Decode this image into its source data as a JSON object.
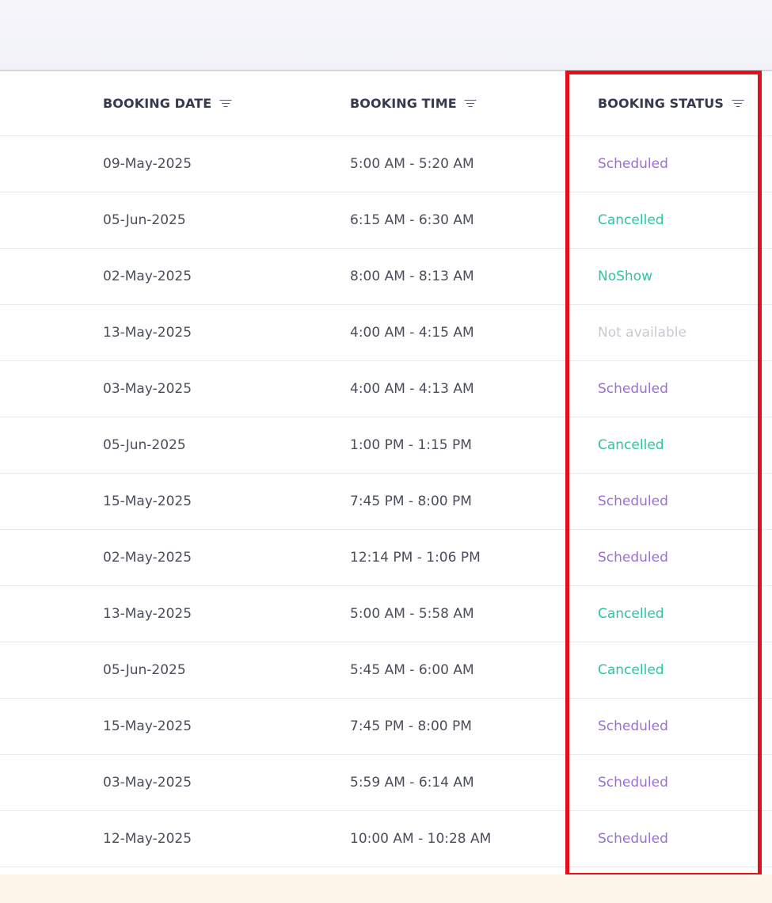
{
  "table": {
    "columns": [
      {
        "label": "BOOKING DATE"
      },
      {
        "label": "BOOKING TIME"
      },
      {
        "label": "BOOKING STATUS"
      }
    ],
    "rows": [
      {
        "date": "09-May-2025",
        "time": "5:00 AM - 5:20 AM",
        "status": "Scheduled"
      },
      {
        "date": "05-Jun-2025",
        "time": "6:15 AM - 6:30 AM",
        "status": "Cancelled"
      },
      {
        "date": "02-May-2025",
        "time": "8:00 AM - 8:13 AM",
        "status": "NoShow"
      },
      {
        "date": "13-May-2025",
        "time": "4:00 AM - 4:15 AM",
        "status": "Not available"
      },
      {
        "date": "03-May-2025",
        "time": "4:00 AM - 4:13 AM",
        "status": "Scheduled"
      },
      {
        "date": "05-Jun-2025",
        "time": "1:00 PM - 1:15 PM",
        "status": "Cancelled"
      },
      {
        "date": "15-May-2025",
        "time": "7:45 PM - 8:00 PM",
        "status": "Scheduled"
      },
      {
        "date": "02-May-2025",
        "time": "12:14 PM - 1:06 PM",
        "status": "Scheduled"
      },
      {
        "date": "13-May-2025",
        "time": "5:00 AM - 5:58 AM",
        "status": "Cancelled"
      },
      {
        "date": "05-Jun-2025",
        "time": "5:45 AM - 6:00 AM",
        "status": "Cancelled"
      },
      {
        "date": "15-May-2025",
        "time": "7:45 PM - 8:00 PM",
        "status": "Scheduled"
      },
      {
        "date": "03-May-2025",
        "time": "5:59 AM - 6:14 AM",
        "status": "Scheduled"
      },
      {
        "date": "12-May-2025",
        "time": "10:00 AM - 10:28 AM",
        "status": "Scheduled"
      }
    ]
  },
  "status_colors": {
    "Scheduled": "#9b6fd6",
    "Cancelled": "#2ec4a6",
    "NoShow": "#2ec4a6",
    "Not available": "#c9cad0"
  },
  "icons": {
    "column_filter": "filter-icon"
  },
  "highlight": {
    "color": "#e3101a"
  }
}
